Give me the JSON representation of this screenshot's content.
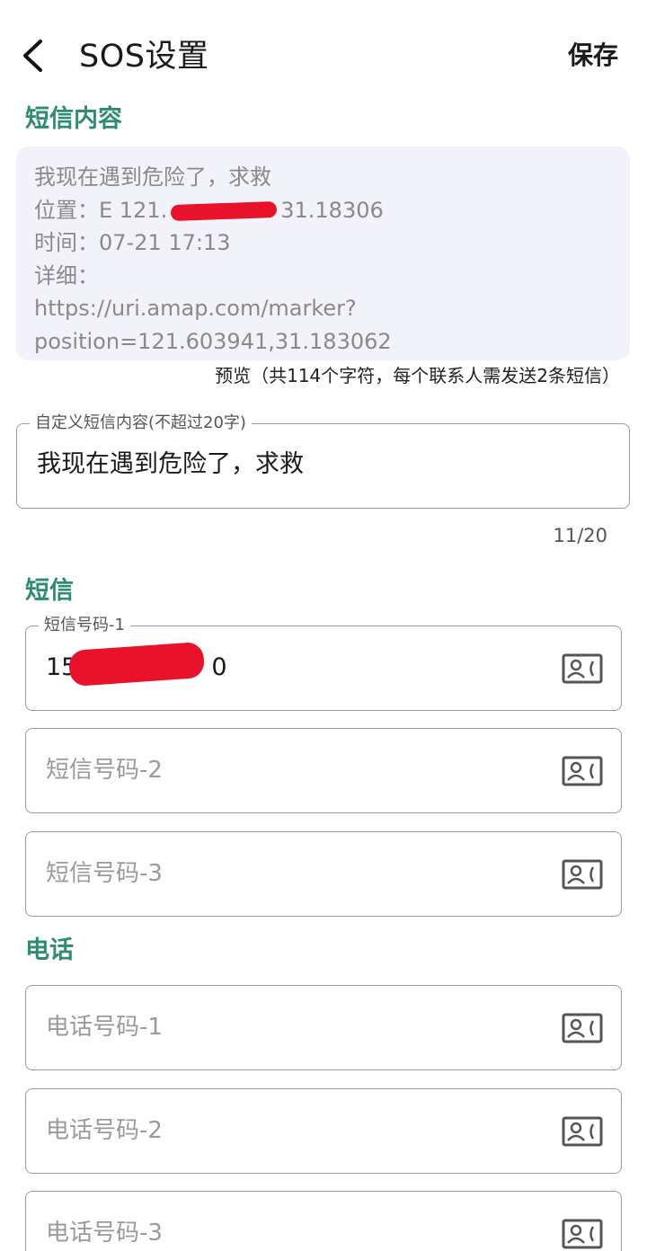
{
  "header": {
    "title": "SOS设置",
    "save_label": "保存"
  },
  "sms_content": {
    "section_label": "短信内容",
    "preview_lines": [
      "我现在遇到危险了，求救",
      "位置：E 121.",
      "31.18306",
      "时间：07-21 17:13",
      "详细：",
      "https://uri.amap.com/marker?",
      "position=121.603941,31.183062"
    ],
    "preview_info": "预览（共114个字符，每个联系人需发送2条短信）",
    "custom_field": {
      "legend": "自定义短信内容(不超过20字)",
      "value": "我现在遇到危险了，求救",
      "counter": "11/20"
    }
  },
  "sms": {
    "section_label": "短信",
    "numbers": [
      {
        "legend": "短信号码-1",
        "value_prefix": "15",
        "value_suffix": "0",
        "placeholder": ""
      },
      {
        "legend": "",
        "value_prefix": "",
        "value_suffix": "",
        "placeholder": "短信号码-2"
      },
      {
        "legend": "",
        "value_prefix": "",
        "value_suffix": "",
        "placeholder": "短信号码-3"
      }
    ]
  },
  "phone": {
    "section_label": "电话",
    "numbers": [
      {
        "placeholder": "电话号码-1"
      },
      {
        "placeholder": "电话号码-2"
      },
      {
        "placeholder": "电话号码-3"
      }
    ]
  },
  "icons": {
    "back": "chevron-left-icon",
    "contact": "contact-card-icon"
  },
  "colors": {
    "accent": "#2f8c72",
    "preview_bg": "#f1f2fa",
    "redaction": "#e8132a"
  }
}
